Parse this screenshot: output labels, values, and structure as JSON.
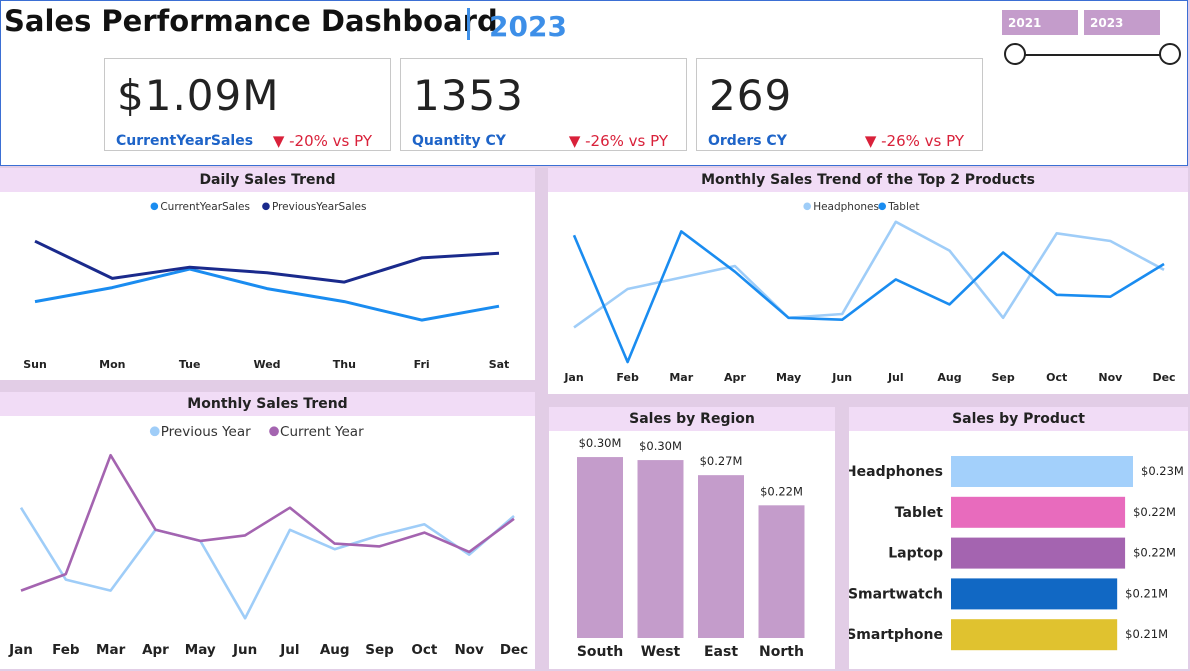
{
  "header": {
    "title": "Sales Performance Dashboard",
    "year": "2023"
  },
  "year_filter": {
    "start": "2021",
    "end": "2023"
  },
  "kpis": [
    {
      "value": "$1.09M",
      "label": "CurrentYearSales",
      "change": "-20% vs PY"
    },
    {
      "value": "1353",
      "label": "Quantity CY",
      "change": "-26% vs PY"
    },
    {
      "value": "269",
      "label": "Orders CY",
      "change": "-26% vs PY"
    }
  ],
  "colors": {
    "accent": "#3d8fe8",
    "negative": "#d9213a",
    "panel_title_bg": "#f1dcf6",
    "page_bg": "#e2cde6"
  },
  "chart_data": [
    {
      "type": "line",
      "title": "Daily Sales Trend",
      "categories": [
        "Sun",
        "Mon",
        "Tue",
        "Wed",
        "Thu",
        "Fri",
        "Sat"
      ],
      "series": [
        {
          "name": "CurrentYearSales",
          "color": "#1a8cf0",
          "values": [
            150,
            165,
            185,
            164,
            150,
            130,
            145
          ]
        },
        {
          "name": "PreviousYearSales",
          "color": "#1a2a8c",
          "values": [
            215,
            175,
            187,
            181,
            171,
            197,
            202
          ]
        }
      ],
      "ylim": [
        100,
        240
      ],
      "legend": "top-center",
      "grid": false
    },
    {
      "type": "line",
      "title": "Monthly Sales Trend of the Top 2 Products",
      "categories": [
        "Jan",
        "Feb",
        "Mar",
        "Apr",
        "May",
        "Jun",
        "Jul",
        "Aug",
        "Sep",
        "Oct",
        "Nov",
        "Dec"
      ],
      "series": [
        {
          "name": "Headphones",
          "color": "#9fcdf8",
          "values": [
            18,
            20,
            20.6,
            21.2,
            18.5,
            18.7,
            23.5,
            22,
            18.5,
            22.9,
            22.5,
            21
          ]
        },
        {
          "name": "Tablet",
          "color": "#1a8cf0",
          "values": [
            22.8,
            16.2,
            23,
            20.9,
            18.5,
            18.4,
            20.5,
            19.2,
            21.9,
            19.7,
            19.6,
            21.3
          ]
        }
      ],
      "ylim": [
        15,
        25
      ],
      "legend": "top-center",
      "grid": false
    },
    {
      "type": "line",
      "title": "Monthly Sales Trend",
      "categories": [
        "Jan",
        "Feb",
        "Mar",
        "Apr",
        "May",
        "Jun",
        "Jul",
        "Aug",
        "Sep",
        "Oct",
        "Nov",
        "Dec"
      ],
      "series": [
        {
          "name": "Previous Year",
          "color": "#9fcdf8",
          "values": [
            114,
            88,
            84,
            106,
            102,
            74,
            106,
            99,
            104,
            108,
            97,
            111
          ]
        },
        {
          "name": "Current Year",
          "color": "#a464b0",
          "values": [
            84,
            90,
            133,
            106,
            102,
            104,
            114,
            101,
            100,
            105,
            98,
            110
          ]
        }
      ],
      "ylim": [
        60,
        145
      ],
      "legend": "top-center",
      "grid": false
    },
    {
      "type": "bar",
      "title": "Sales by Region",
      "categories": [
        "South",
        "West",
        "East",
        "North"
      ],
      "values": [
        0.3,
        0.295,
        0.27,
        0.22
      ],
      "data_labels": [
        "$0.30M",
        "$0.30M",
        "$0.27M",
        "$0.22M"
      ],
      "color": "#c49ccb",
      "ylim": [
        0,
        0.32
      ]
    },
    {
      "type": "bar",
      "orientation": "horizontal",
      "title": "Sales by Product",
      "categories": [
        "Headphones",
        "Tablet",
        "Laptop",
        "Smartwatch",
        "Smartphone"
      ],
      "values": [
        0.23,
        0.22,
        0.22,
        0.21,
        0.21
      ],
      "data_labels": [
        "$0.23M",
        "$0.22M",
        "$0.22M",
        "$0.21M",
        "$0.21M"
      ],
      "colors": [
        "#a3d0fb",
        "#e86bbd",
        "#a464b0",
        "#1168c4",
        "#e0c22f"
      ],
      "xlim": [
        0,
        0.23
      ]
    }
  ]
}
